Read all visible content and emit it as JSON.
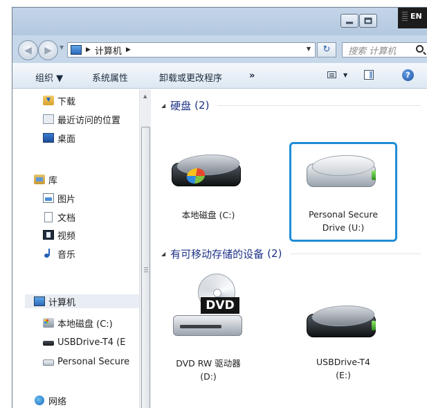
{
  "window": {
    "language_indicator": "EN"
  },
  "address_bar": {
    "crumbs": [
      "计算机"
    ],
    "search_placeholder": "搜索 计算机"
  },
  "command_bar": {
    "organize": "组织 ▼",
    "system_properties": "系统属性",
    "uninstall": "卸载或更改程序",
    "more": "»"
  },
  "nav_pane": {
    "favorites": [
      {
        "label": "下载",
        "icon": "download-folder-icon"
      },
      {
        "label": "最近访问的位置",
        "icon": "recent-places-icon"
      },
      {
        "label": "桌面",
        "icon": "desktop-icon"
      }
    ],
    "library": {
      "label": "库",
      "icon": "library-icon"
    },
    "library_items": [
      {
        "label": "图片",
        "icon": "pictures-icon"
      },
      {
        "label": "文档",
        "icon": "documents-icon"
      },
      {
        "label": "视频",
        "icon": "videos-icon"
      },
      {
        "label": "音乐",
        "icon": "music-icon"
      }
    ],
    "computer": {
      "label": "计算机",
      "icon": "computer-icon"
    },
    "computer_items": [
      {
        "label": "本地磁盘 (C:)",
        "icon": "local-disk-icon"
      },
      {
        "label": "USBDrive-T4 (E",
        "icon": "usb-drive-icon"
      },
      {
        "label": "Personal Secure",
        "icon": "secure-drive-icon"
      }
    ],
    "network": {
      "label": "网络",
      "icon": "network-icon"
    }
  },
  "content": {
    "hard_disks": {
      "title": "硬盘",
      "count": "(2)",
      "items": [
        {
          "label_lines": [
            "本地磁盘 (C:)"
          ]
        },
        {
          "label_lines": [
            "Personal Secure",
            "Drive (U:)"
          ]
        }
      ]
    },
    "removable": {
      "title": "有可移动存储的设备",
      "count": "(2)",
      "items": [
        {
          "label_lines": [
            "DVD RW 驱动器",
            "(D:)"
          ],
          "badge": "DVD"
        },
        {
          "label_lines": [
            "USBDrive-T4",
            "(E:)"
          ]
        }
      ]
    }
  },
  "colors": {
    "highlight_border": "#1f8dd6",
    "group_title": "#1e3287"
  }
}
